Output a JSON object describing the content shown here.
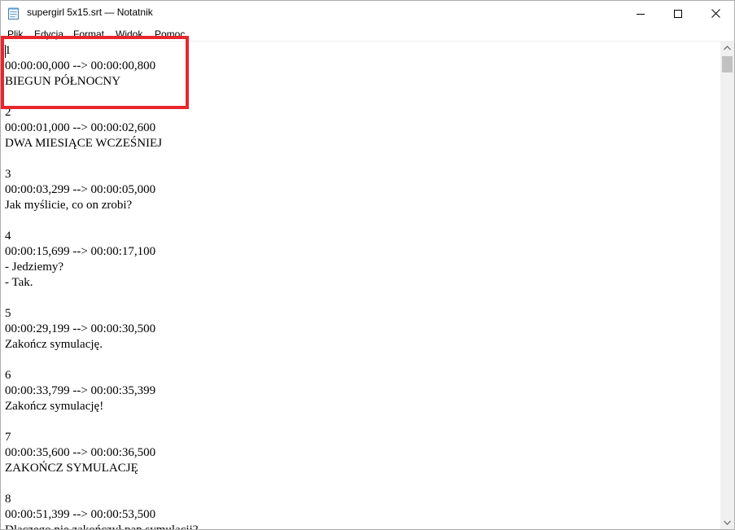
{
  "window": {
    "title": "supergirl 5x15.srt — Notatnik",
    "app_icon": "notepad-icon",
    "controls": {
      "minimize_icon": "minimize-icon",
      "maximize_icon": "maximize-icon",
      "close_icon": "close-icon"
    }
  },
  "menu": {
    "items": [
      {
        "label": "Plik"
      },
      {
        "label": "Edycja"
      },
      {
        "label": "Format"
      },
      {
        "label": "Widok"
      },
      {
        "label": "Pomoc"
      }
    ]
  },
  "editor": {
    "lines": [
      "1",
      "00:00:00,000 --> 00:00:00,800",
      "BIEGUN PÓŁNOCNY",
      "",
      "2",
      "00:00:01,000 --> 00:00:02,600",
      "DWA MIESIĄCE WCZEŚNIEJ",
      "",
      "3",
      "00:00:03,299 --> 00:00:05,000",
      "Jak myślicie, co on zrobi?",
      "",
      "4",
      "00:00:15,699 --> 00:00:17,100",
      "- Jedziemy?",
      "- Tak.",
      "",
      "5",
      "00:00:29,199 --> 00:00:30,500",
      "Zakończ symulację.",
      "",
      "6",
      "00:00:33,799 --> 00:00:35,399",
      "Zakończ symulację!",
      "",
      "7",
      "00:00:35,600 --> 00:00:36,500",
      "ZAKOŃCZ SYMULACJĘ",
      "",
      "8",
      "00:00:51,399 --> 00:00:53,500",
      "Dlaczego nie zakończył pan symulacji?"
    ]
  },
  "annotation": {
    "color": "#e8262b"
  }
}
